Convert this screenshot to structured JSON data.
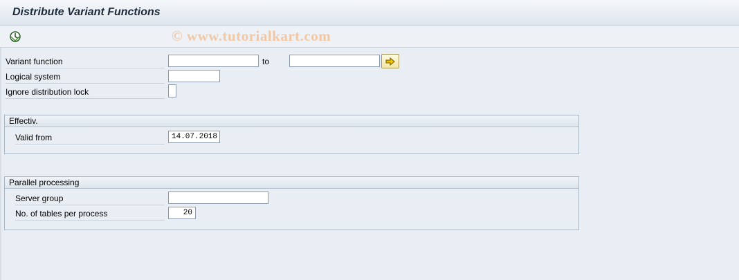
{
  "window": {
    "title": "Distribute Variant Functions"
  },
  "toolbar": {
    "execute_icon": "execute-clock-icon",
    "watermark": "© www.tutorialkart.com"
  },
  "selection": {
    "variant_function_label": "Variant function",
    "variant_function_from": "",
    "to_label": "to",
    "variant_function_to": "",
    "multiple_selection_icon": "multiple-selection-arrow-icon",
    "logical_system_label": "Logical system",
    "logical_system_value": "",
    "ignore_lock_label": "Ignore distribution lock",
    "ignore_lock_checked": false
  },
  "effectiv": {
    "header": "Effectiv.",
    "valid_from_label": "Valid from",
    "valid_from_value": "14.07.2018"
  },
  "parallel": {
    "header": "Parallel processing",
    "server_group_label": "Server group",
    "server_group_value": "",
    "tables_label": "No. of tables per process",
    "tables_value": "20"
  }
}
